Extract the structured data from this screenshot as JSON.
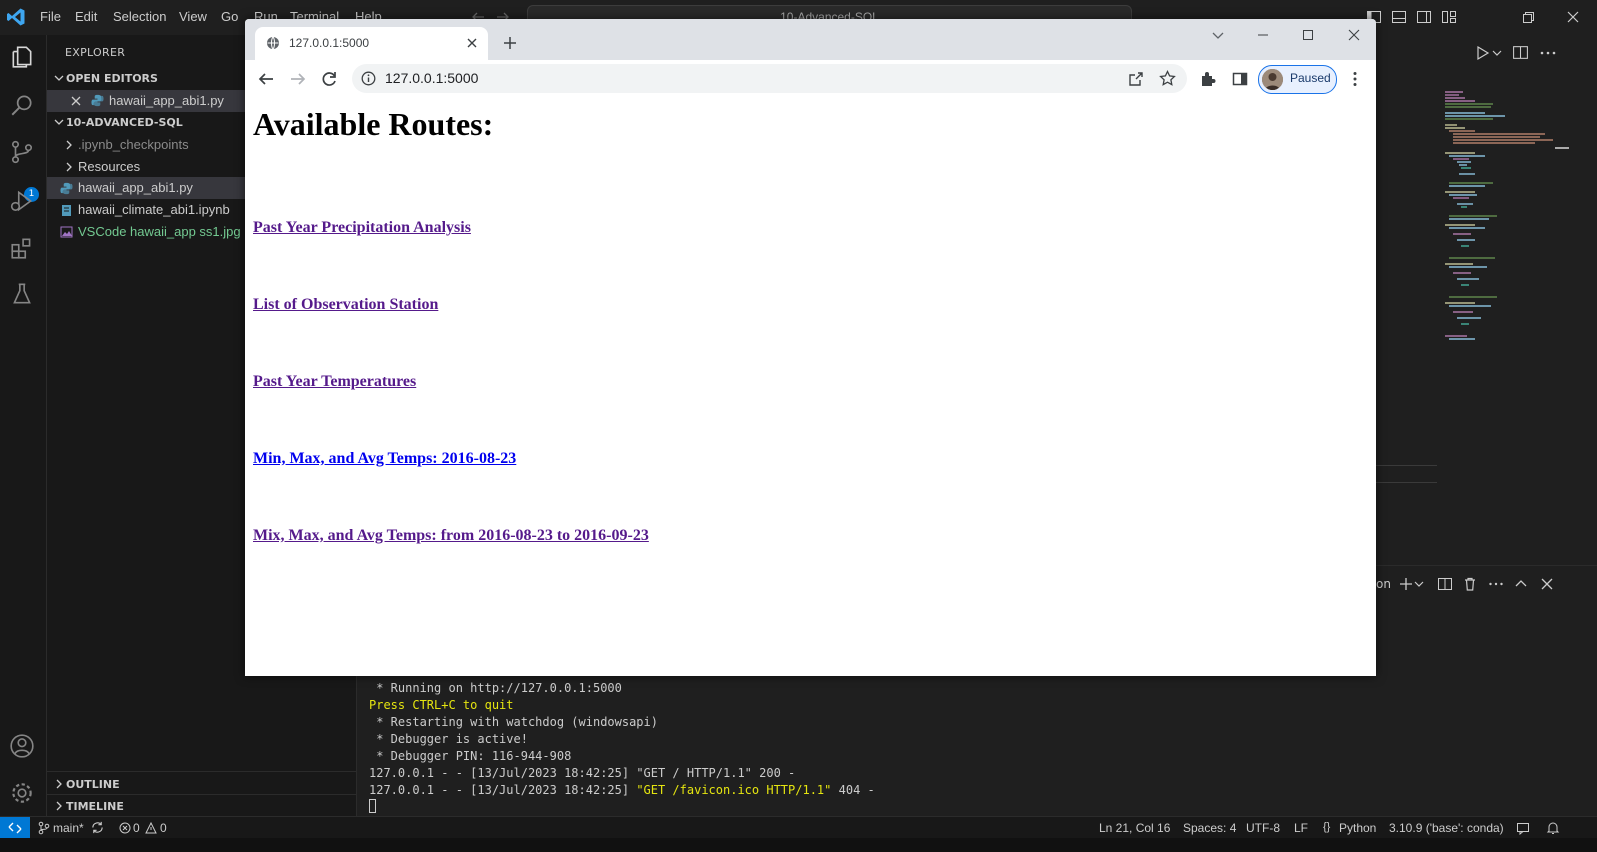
{
  "vscode": {
    "menu": [
      "File",
      "Edit",
      "Selection",
      "View",
      "Go",
      "Run",
      "Terminal",
      "Help"
    ],
    "command_center": "10-Advanced-SQL",
    "sidebar": {
      "title": "EXPLORER",
      "open_editors_label": "OPEN EDITORS",
      "open_editor_file": "hawaii_app_abi1.py",
      "folder_label": "10-ADVANCED-SQL",
      "items": [
        {
          "label": ".ipynb_checkpoints",
          "type": "folder"
        },
        {
          "label": "Resources",
          "type": "folder"
        },
        {
          "label": "hawaii_app_abi1.py",
          "type": "python"
        },
        {
          "label": "hawaii_climate_abi1.ipynb",
          "type": "notebook"
        },
        {
          "label": "VSCode hawaii_app ss1.jpg",
          "type": "image"
        }
      ],
      "outline_label": "OUTLINE",
      "timeline_label": "TIMELINE"
    },
    "scm_badge": "1",
    "panel_tab_fragment": "on",
    "terminal_lines": [
      {
        "text": " * Running on http://127.0.0.1:5000",
        "color": "default"
      },
      {
        "text": "Press CTRL+C to quit",
        "color": "yellow"
      },
      {
        "text": " * Restarting with watchdog (windowsapi)",
        "color": "default"
      },
      {
        "text": " * Debugger is active!",
        "color": "default"
      },
      {
        "text": " * Debugger PIN: 116-944-908",
        "color": "default"
      }
    ],
    "log_lines": [
      {
        "prefix": "127.0.0.1 - - [13/Jul/2023 18:42:25] ",
        "request": "\"GET / HTTP/1.1\"",
        "suffix": " 200 -",
        "request_color": "default"
      },
      {
        "prefix": "127.0.0.1 - - [13/Jul/2023 18:42:25] ",
        "request": "\"GET /favicon.ico HTTP/1.1\"",
        "suffix": " 404 -",
        "request_color": "yellow"
      }
    ],
    "statusbar": {
      "branch": "main*",
      "errors": "0",
      "warnings": "0",
      "cursor": "Ln 21, Col 16",
      "spaces": "Spaces: 4",
      "encoding": "UTF-8",
      "eol": "LF",
      "language": "Python",
      "interpreter": "3.10.9 ('base': conda)"
    }
  },
  "browser": {
    "tab_title": "127.0.0.1:5000",
    "url": "127.0.0.1:5000",
    "profile_label": "Paused"
  },
  "page": {
    "title": "Available Routes:",
    "links": [
      {
        "text": "Past Year Precipitation Analysis",
        "visited": true
      },
      {
        "text": "List of Observation Station",
        "visited": true
      },
      {
        "text": "Past Year Temperatures",
        "visited": true
      },
      {
        "text": "Min, Max, and Avg Temps: 2016-08-23",
        "visited": false
      },
      {
        "text": "Mix, Max, and Avg Temps: from 2016-08-23 to 2016-09-23",
        "visited": true
      }
    ]
  },
  "colors": {
    "vscode_accent": "#0078d4",
    "visited_link": "#551a8b",
    "unvisited_link": "#0000ee",
    "terminal_yellow": "#e5e510",
    "file_image_green": "#73c991"
  }
}
